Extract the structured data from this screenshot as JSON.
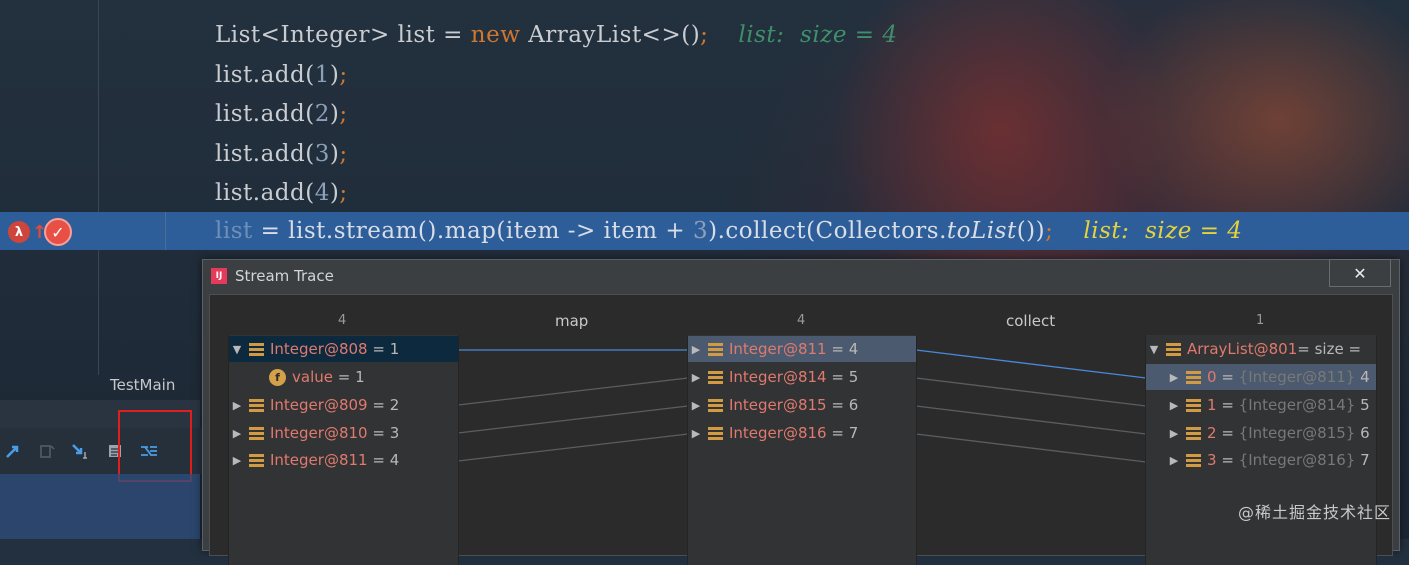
{
  "editor": {
    "lines": [
      {
        "text1": "List<Integer> list = ",
        "kw": "new",
        "text2": " ArrayList<>()",
        "punc": ";",
        "hint": "list:  size = 4"
      },
      {
        "text": "list.add(",
        "num": "1",
        "tail": ")",
        "punc": ";"
      },
      {
        "text": "list.add(",
        "num": "2",
        "tail": ")",
        "punc": ";"
      },
      {
        "text": "list.add(",
        "num": "3",
        "tail": ")",
        "punc": ";"
      },
      {
        "text": "list.add(",
        "num": "4",
        "tail": ")",
        "punc": ";"
      }
    ],
    "highlighted": {
      "var": "list",
      "part1": " = list.stream().map(item -> item + ",
      "num": "3",
      "part2": ").collect(Collectors.",
      "method": "toList",
      "part3": "())",
      "punc": ";",
      "hint": "list:  size = 4"
    }
  },
  "gutter": {
    "lambda_icon": "λ",
    "arrow_icon": "↑",
    "breakpoint_icon": "✓"
  },
  "bottom": {
    "tab_label": "TestMain"
  },
  "toolbar": {
    "icons": [
      "step-out-icon",
      "drop-frame-icon",
      "step-into-icon",
      "evaluate-icon",
      "trace-stream-icon"
    ]
  },
  "dialog": {
    "title": "Stream Trace",
    "close_label": "✕",
    "col_counts": [
      "4",
      "4",
      "1"
    ],
    "operations": [
      "map",
      "collect"
    ],
    "col1": [
      {
        "obj": "Integer@808",
        "val": "1",
        "expanded": true
      },
      {
        "child": true,
        "field": "value",
        "val": "1"
      },
      {
        "obj": "Integer@809",
        "val": "2"
      },
      {
        "obj": "Integer@810",
        "val": "3"
      },
      {
        "obj": "Integer@811",
        "val": "4"
      }
    ],
    "col2": [
      {
        "obj": "Integer@811",
        "val": "4"
      },
      {
        "obj": "Integer@814",
        "val": "5"
      },
      {
        "obj": "Integer@815",
        "val": "6"
      },
      {
        "obj": "Integer@816",
        "val": "7"
      }
    ],
    "col3": {
      "root_obj": "ArrayList@801",
      "root_tail": " =  size =",
      "items": [
        {
          "idx": "0",
          "ref": "{Integer@811}",
          "val": "4"
        },
        {
          "idx": "1",
          "ref": "{Integer@814}",
          "val": "5"
        },
        {
          "idx": "2",
          "ref": "{Integer@815}",
          "val": "6"
        },
        {
          "idx": "3",
          "ref": "{Integer@816}",
          "val": "7"
        }
      ]
    }
  },
  "watermark": "@稀土掘金技术社区",
  "colors": {
    "highlight": "#2d5e9a",
    "hint": "#3f8f6a",
    "hint_active": "#e6d23a",
    "object": "#e07a6e",
    "red_box": "#e01e1e"
  }
}
